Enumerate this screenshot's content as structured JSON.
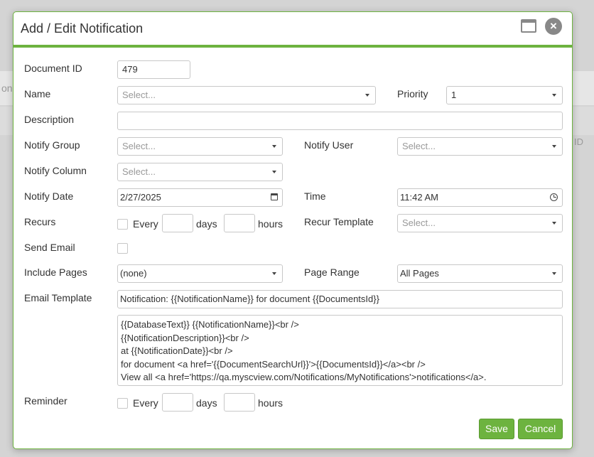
{
  "background": {
    "fragment_left": "on",
    "fragment_right": "ID"
  },
  "dialog": {
    "title": "Add / Edit Notification",
    "icons": {
      "maximize": "maximize-icon",
      "close": "close-icon"
    }
  },
  "labels": {
    "document_id": "Document ID",
    "name": "Name",
    "priority": "Priority",
    "description": "Description",
    "notify_group": "Notify Group",
    "notify_user": "Notify User",
    "notify_column": "Notify Column",
    "notify_date": "Notify Date",
    "time": "Time",
    "recurs": "Recurs",
    "recur_template": "Recur Template",
    "send_email": "Send Email",
    "include_pages": "Include Pages",
    "page_range": "Page Range",
    "email_template": "Email Template",
    "reminder": "Reminder",
    "every": "Every",
    "days": "days",
    "hours": "hours"
  },
  "fields": {
    "document_id": "479",
    "name_placeholder": "Select...",
    "priority": "1",
    "description": "",
    "notify_group_placeholder": "Select...",
    "notify_user_placeholder": "Select...",
    "notify_column_placeholder": "Select...",
    "notify_date": "2/27/2025",
    "time": "11:42 AM",
    "recur_template_placeholder": "Select...",
    "include_pages": "(none)",
    "page_range": "All Pages",
    "email_subject": "Notification: {{NotificationName}} for document {{DocumentsId}}",
    "email_body": [
      "{{DatabaseText}} {{NotificationName}}<br />",
      "{{NotificationDescription}}<br />",
      "at {{NotificationDate}}<br />",
      "for document <a href='{{DocumentSearchUrl}}'>{{DocumentsId}}</a><br />",
      "View all <a href='https://qa.myscview.com/Notifications/MyNotifications'>notifications</a>."
    ]
  },
  "buttons": {
    "save": "Save",
    "cancel": "Cancel"
  },
  "colors": {
    "accent": "#6db33f"
  }
}
